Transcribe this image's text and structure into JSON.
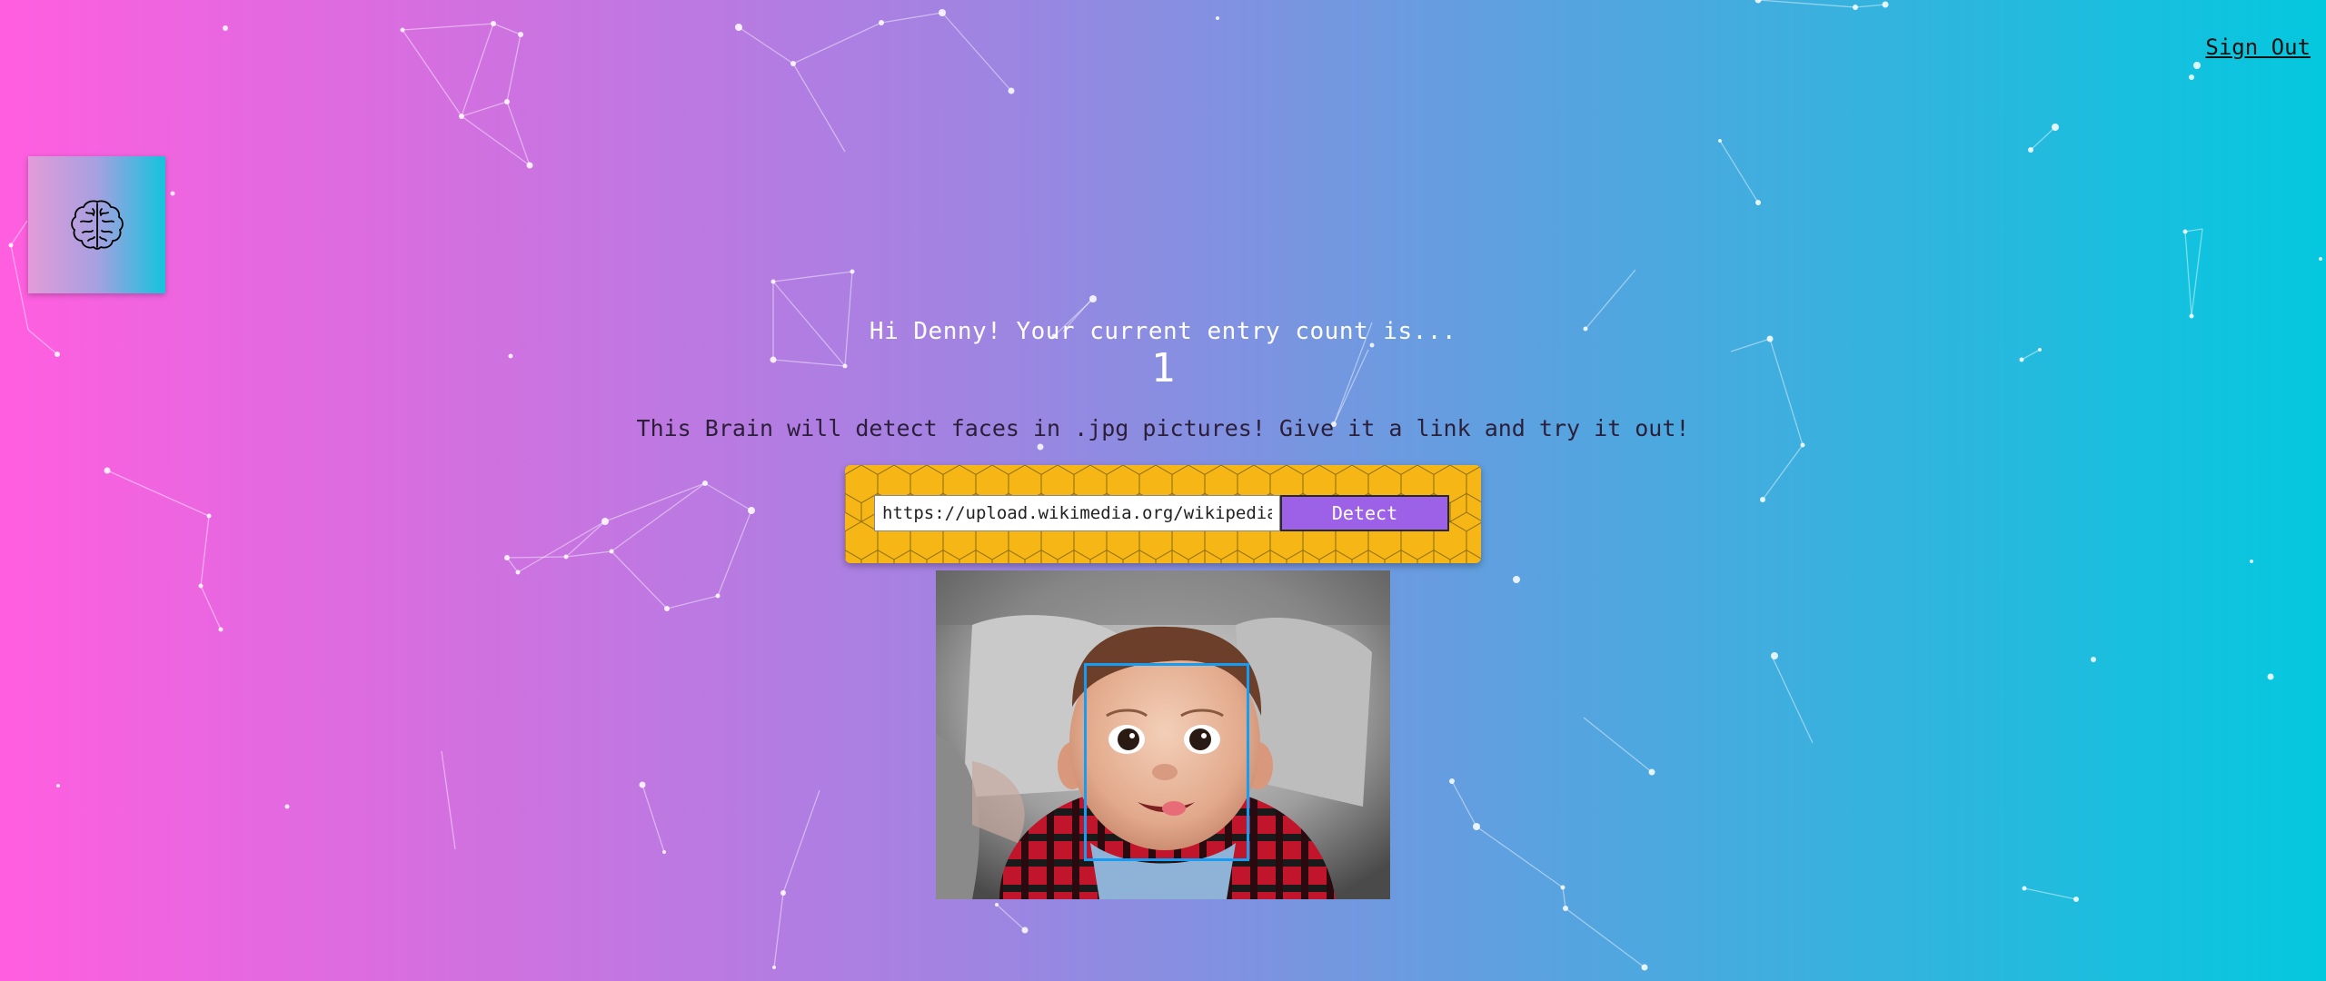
{
  "header": {
    "sign_out_label": "Sign Out"
  },
  "logo": {
    "icon": "brain-icon"
  },
  "rank": {
    "greeting": "Hi Denny! Your current entry count is...",
    "count": "1"
  },
  "description": "This Brain will detect faces in .jpg pictures! Give it a link and try it out!",
  "form": {
    "url_value": "https://upload.wikimedia.org/wikipedia/commons/baby.jpg",
    "detect_label": "Detect"
  },
  "colors": {
    "gradient_start": "#ff5edf",
    "gradient_end": "#04c8de",
    "panel": "#f6b716",
    "button": "#9d61e8",
    "face_box": "#149df2"
  }
}
